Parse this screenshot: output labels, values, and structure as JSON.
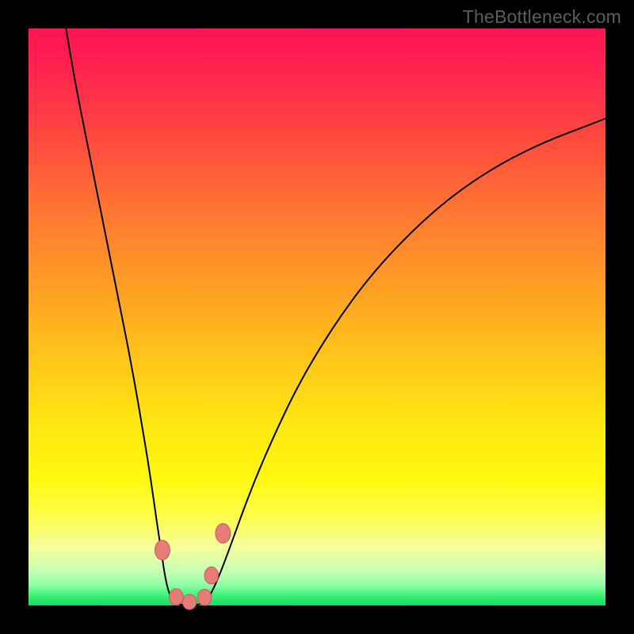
{
  "watermark": "TheBottleneck.com",
  "chart_data": {
    "type": "line",
    "title": "",
    "xlabel": "",
    "ylabel": "",
    "xlim": [
      0,
      100
    ],
    "ylim": [
      0,
      100
    ],
    "grid": false,
    "annotations": [],
    "segments": [
      {
        "name": "left-curve",
        "points": [
          [
            6.5,
            100
          ],
          [
            7.5,
            94
          ],
          [
            8.8,
            87
          ],
          [
            10.2,
            80
          ],
          [
            11.6,
            73
          ],
          [
            13.0,
            66
          ],
          [
            14.4,
            59
          ],
          [
            15.8,
            52
          ],
          [
            17.2,
            45
          ],
          [
            18.5,
            38
          ],
          [
            19.7,
            31
          ],
          [
            20.7,
            25
          ],
          [
            21.6,
            19
          ],
          [
            22.3,
            14
          ],
          [
            23.0,
            9.5
          ],
          [
            23.5,
            6.0
          ],
          [
            24.0,
            3.4
          ],
          [
            24.5,
            1.8
          ],
          [
            25.0,
            0.9
          ],
          [
            25.6,
            0.35
          ],
          [
            26.4,
            0.15
          ]
        ]
      },
      {
        "name": "bottom",
        "points": [
          [
            26.4,
            0.15
          ],
          [
            27.2,
            0.1
          ],
          [
            28.0,
            0.1
          ],
          [
            28.8,
            0.12
          ],
          [
            29.6,
            0.2
          ],
          [
            30.4,
            0.4
          ]
        ]
      },
      {
        "name": "right-curve",
        "points": [
          [
            30.4,
            0.4
          ],
          [
            31.1,
            1.2
          ],
          [
            31.9,
            2.6
          ],
          [
            32.8,
            4.6
          ],
          [
            34.0,
            7.6
          ],
          [
            35.6,
            12.0
          ],
          [
            37.6,
            17.5
          ],
          [
            40.0,
            23.6
          ],
          [
            43.0,
            30.4
          ],
          [
            46.4,
            37.5
          ],
          [
            50.4,
            44.5
          ],
          [
            55.0,
            51.5
          ],
          [
            60.0,
            58.0
          ],
          [
            65.4,
            63.8
          ],
          [
            71.0,
            69.0
          ],
          [
            76.8,
            73.4
          ],
          [
            83.0,
            77.2
          ],
          [
            89.6,
            80.4
          ],
          [
            96.4,
            83.0
          ],
          [
            100.0,
            84.4
          ]
        ]
      }
    ],
    "markers": [
      {
        "x": 23.2,
        "y": 9.6,
        "rx": 1.3,
        "ry": 1.7
      },
      {
        "x": 25.6,
        "y": 1.5,
        "rx": 1.2,
        "ry": 1.4
      },
      {
        "x": 27.9,
        "y": 0.6,
        "rx": 1.2,
        "ry": 1.3
      },
      {
        "x": 30.5,
        "y": 1.4,
        "rx": 1.2,
        "ry": 1.4
      },
      {
        "x": 31.7,
        "y": 5.2,
        "rx": 1.2,
        "ry": 1.5
      },
      {
        "x": 33.7,
        "y": 12.5,
        "rx": 1.3,
        "ry": 1.7
      }
    ],
    "colors": {
      "curve": "#000000",
      "marker_fill": "#e77b78",
      "marker_stroke": "#c85a56"
    }
  }
}
